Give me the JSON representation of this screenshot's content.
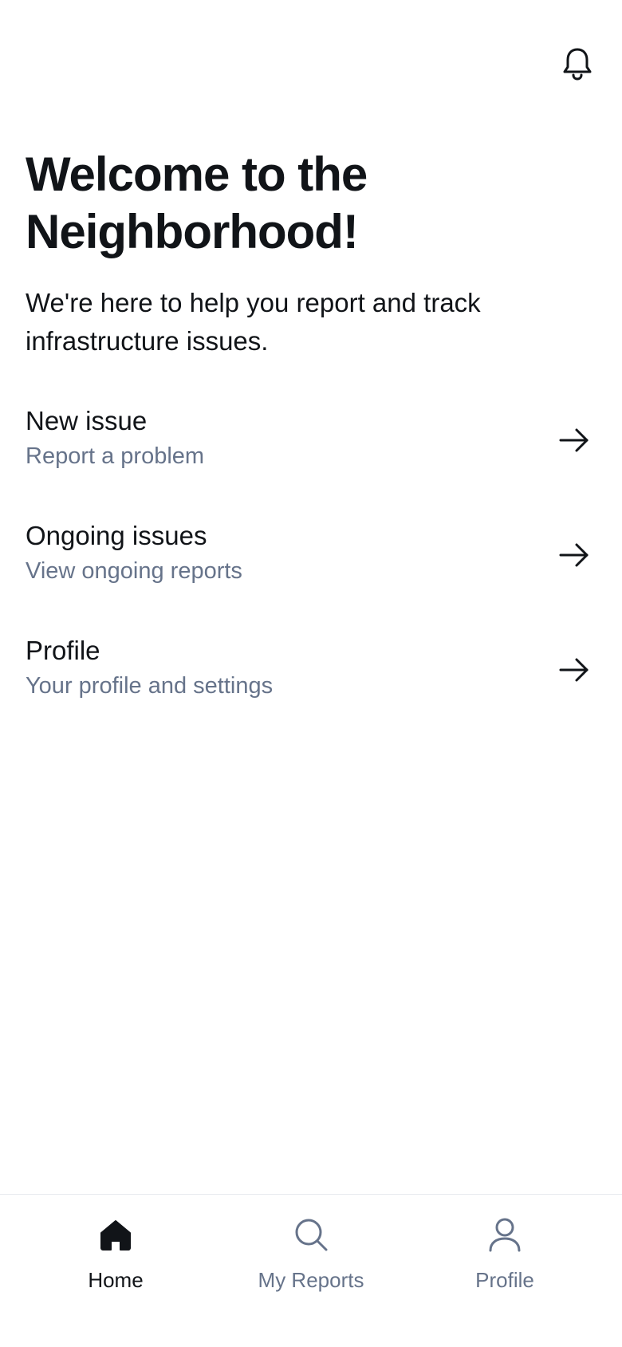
{
  "header": {
    "bell_icon": "bell-icon"
  },
  "main": {
    "title": "Welcome to the Neighborhood!",
    "subtitle": "We're here to help you report and track infrastructure issues.",
    "items": [
      {
        "title": "New issue",
        "subtitle": "Report a problem",
        "icon": "arrow-right-icon"
      },
      {
        "title": "Ongoing issues",
        "subtitle": "View ongoing reports",
        "icon": "arrow-right-icon"
      },
      {
        "title": "Profile",
        "subtitle": "Your profile and settings",
        "icon": "arrow-right-icon"
      }
    ]
  },
  "bottom_nav": {
    "active_tab": "Home",
    "tabs": [
      {
        "label": "Home",
        "icon": "home-icon"
      },
      {
        "label": "My Reports",
        "icon": "search-icon"
      },
      {
        "label": "Profile",
        "icon": "user-icon"
      }
    ]
  },
  "colors": {
    "text_primary": "#111418",
    "text_secondary": "#66738a",
    "nav_inactive": "#66738a",
    "nav_active": "#111418",
    "divider": "#e7e9ee",
    "background": "#ffffff"
  }
}
